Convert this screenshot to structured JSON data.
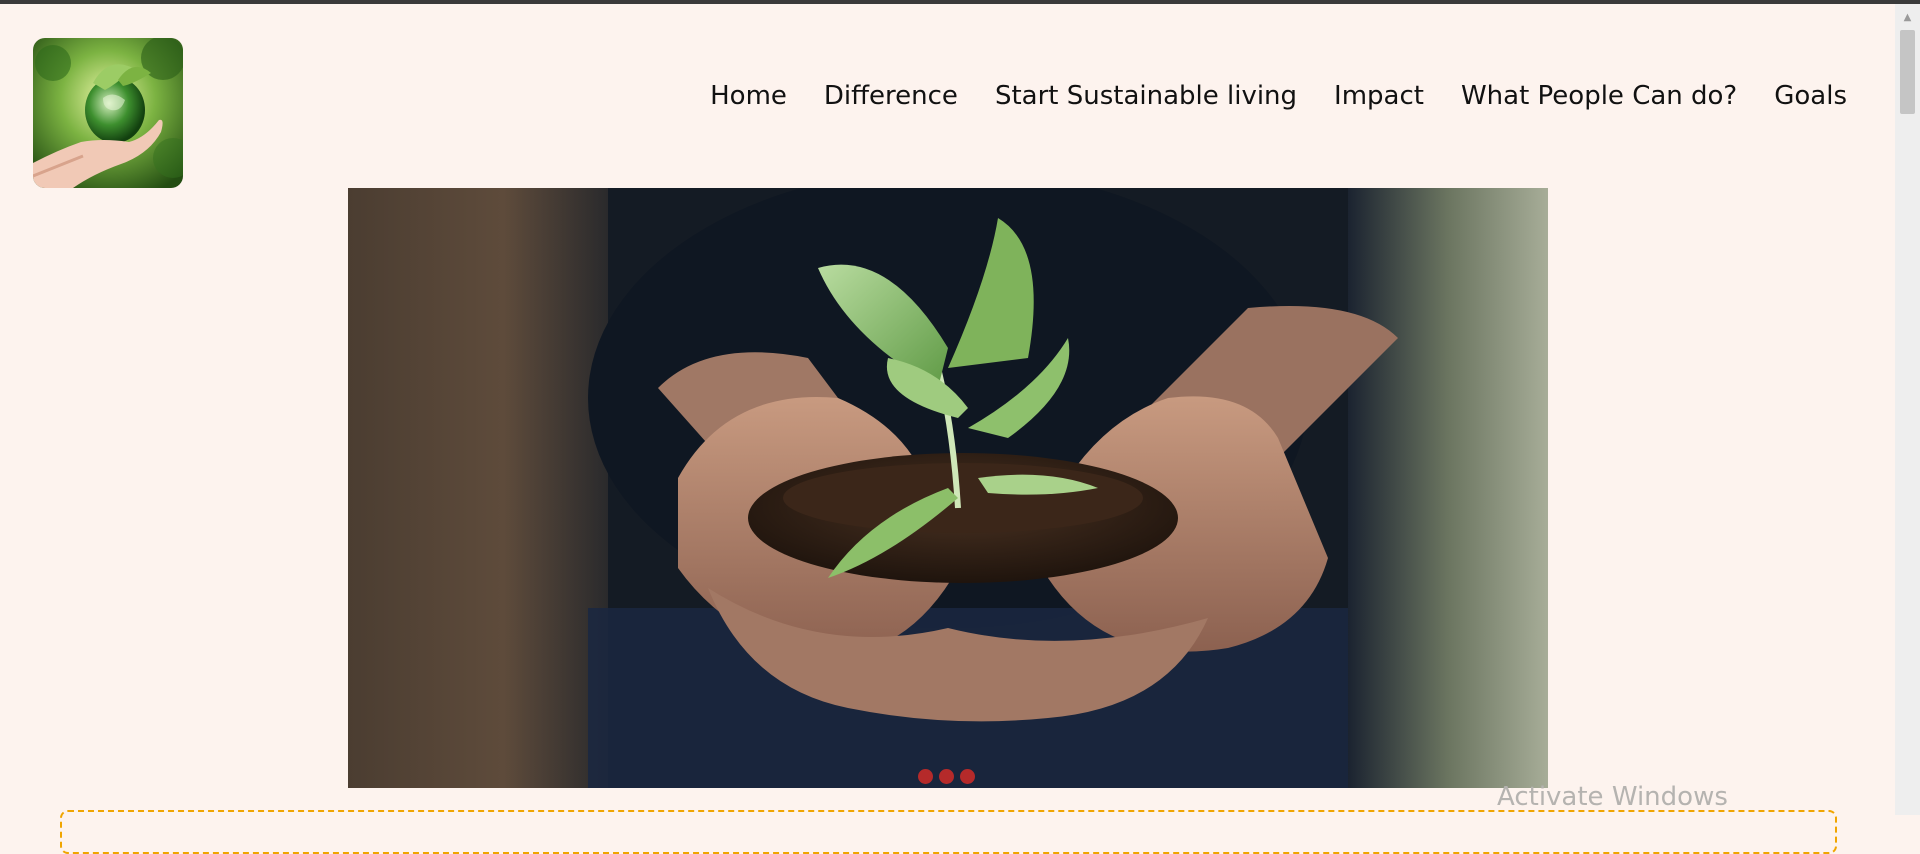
{
  "header": {
    "logo_icon": "globe-in-hand-logo",
    "nav": [
      {
        "label": "Home"
      },
      {
        "label": "Difference"
      },
      {
        "label": "Start Sustainable living"
      },
      {
        "label": "Impact"
      },
      {
        "label": "What People Can do?"
      },
      {
        "label": "Goals"
      }
    ]
  },
  "hero": {
    "image": "hands-holding-soil-with-seedling",
    "carousel_dots": 3,
    "dot_color": "#b52a2a"
  },
  "watermark": "Activate Windows",
  "colors": {
    "page_bg": "#fdf3ee",
    "accent_dashed": "#f0a500"
  }
}
